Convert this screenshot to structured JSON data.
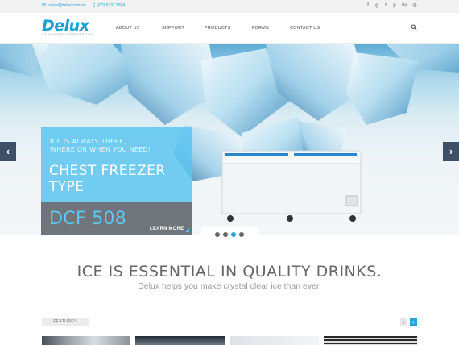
{
  "topbar": {
    "email": "sales@delux.com.au",
    "phone": "(02) 9737 9894",
    "social": [
      {
        "icon": "facebook-icon",
        "glyph": "f"
      },
      {
        "icon": "google-plus-icon",
        "glyph": "g"
      },
      {
        "icon": "twitter-icon",
        "glyph": "t"
      },
      {
        "icon": "pinterest-icon",
        "glyph": "p"
      },
      {
        "icon": "behance-icon",
        "glyph": "Bē"
      },
      {
        "icon": "dribbble-icon",
        "glyph": "◎"
      }
    ]
  },
  "header": {
    "logo_text": "Delux",
    "logo_tagline": "ICE MACHINES & REFRIGERATION",
    "nav": [
      "ABOUT US",
      "SUPPORT",
      "PRODUCTS",
      "FORMS",
      "CONTACT US"
    ]
  },
  "hero": {
    "small_text_line1": "ICE IS ALWAYS THERE,",
    "small_text_line2": "WHERE OR WHEN YOU NEED!",
    "title_line1": "CHEST FREEZER",
    "title_line2": "TYPE",
    "model": "DCF 508",
    "cta": "LEARN MORE",
    "prev": "‹",
    "next": "›",
    "slides": 4,
    "active_slide": 3
  },
  "section": {
    "headline": "ICE IS ESSENTIAL IN QUALITY DRINKS.",
    "subline": "Delux helps you make crystal clear ice than ever."
  },
  "features": {
    "label": "FEATURES",
    "prev": "‹",
    "next": "›"
  },
  "colors": {
    "accent": "#29a3d8",
    "nav_text": "#444444",
    "panel_blue": "#5cc4f0",
    "panel_gray": "#646970",
    "arrow_bg": "#3d5068"
  }
}
